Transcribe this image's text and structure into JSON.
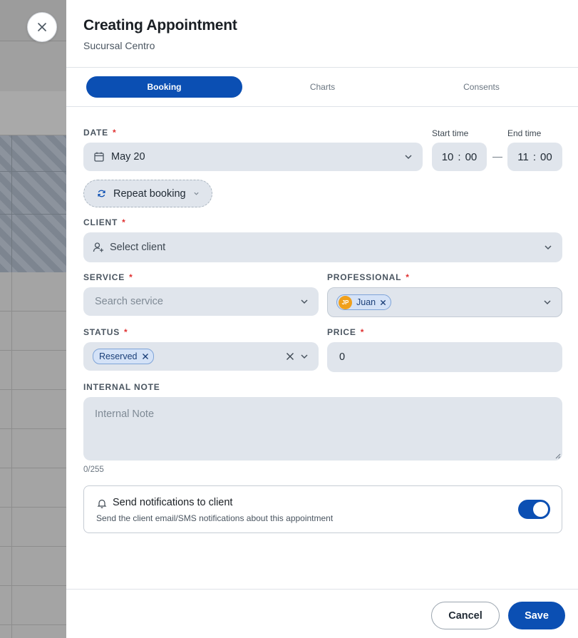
{
  "header": {
    "title": "Creating Appointment",
    "subtitle": "Sucursal Centro"
  },
  "tabs": [
    {
      "label": "Booking",
      "active": true
    },
    {
      "label": "Charts",
      "active": false
    },
    {
      "label": "Consents",
      "active": false
    }
  ],
  "form": {
    "date": {
      "label": "DATE",
      "required": "*",
      "value": "May 20"
    },
    "start_time": {
      "label": "Start time",
      "hour": "10",
      "minute": "00"
    },
    "end_time": {
      "label": "End time",
      "hour": "11",
      "minute": "00"
    },
    "time_separator": "—",
    "repeat": {
      "label": "Repeat booking"
    },
    "client": {
      "label": "CLIENT",
      "required": "*",
      "placeholder": "Select client"
    },
    "service": {
      "label": "SERVICE",
      "required": "*",
      "placeholder": "Search service"
    },
    "professional": {
      "label": "PROFESSIONAL",
      "required": "*",
      "chip_label": "Juan",
      "chip_initials": "JP"
    },
    "status": {
      "label": "STATUS",
      "required": "*",
      "chip_label": "Reserved"
    },
    "price": {
      "label": "PRICE",
      "required": "*",
      "value": "0"
    },
    "internal_note": {
      "label": "INTERNAL NOTE",
      "placeholder": "Internal Note",
      "counter": "0/255"
    }
  },
  "notifications": {
    "title": "Send notifications to client",
    "description": "Send the client email/SMS notifications about this appointment",
    "enabled": true
  },
  "footer": {
    "cancel_label": "Cancel",
    "save_label": "Save"
  },
  "colors": {
    "primary": "#0b4fb3",
    "field_bg": "#e0e5ec",
    "required": "#e03131",
    "avatar": "#f0a01b"
  }
}
